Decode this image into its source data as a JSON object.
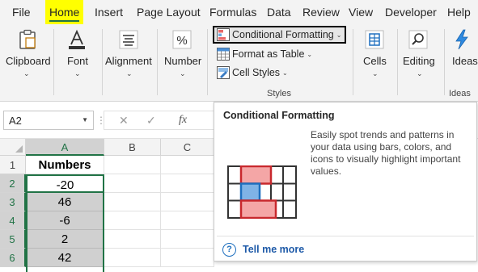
{
  "menu": {
    "tabs": [
      {
        "label": "File",
        "active": false
      },
      {
        "label": "Home",
        "active": true
      },
      {
        "label": "Insert",
        "active": false
      },
      {
        "label": "Page Layout",
        "active": false
      },
      {
        "label": "Formulas",
        "active": false
      },
      {
        "label": "Data",
        "active": false
      },
      {
        "label": "Review",
        "active": false
      },
      {
        "label": "View",
        "active": false
      },
      {
        "label": "Developer",
        "active": false
      },
      {
        "label": "Help",
        "active": false
      }
    ]
  },
  "ribbon": {
    "clipboard": {
      "label": "Clipboard",
      "icon": "clipboard-icon"
    },
    "font": {
      "label": "Font",
      "icon": "font-a-icon"
    },
    "alignment": {
      "label": "Alignment",
      "icon": "align-lines-icon"
    },
    "number": {
      "label": "Number",
      "icon": "percent-icon"
    },
    "styles": {
      "group_label": "Styles",
      "conditional_formatting": "Conditional Formatting",
      "format_as_table": "Format as Table",
      "cell_styles": "Cell Styles"
    },
    "cells": {
      "label": "Cells",
      "icon": "cells-grid-icon"
    },
    "editing": {
      "label": "Editing",
      "icon": "magnifier-icon"
    },
    "ideas": {
      "label": "Ideas",
      "group_label": "Ideas",
      "icon": "lightning-icon"
    }
  },
  "formula_bar": {
    "name_box": "A2",
    "fx_symbol": "fx",
    "formula_value": ""
  },
  "sheet": {
    "columns": [
      "A",
      "B",
      "C"
    ],
    "rows": [
      "1",
      "2",
      "3",
      "4",
      "5",
      "6"
    ],
    "column_a": [
      "Numbers",
      "-20",
      "46",
      "-6",
      "2",
      "42"
    ],
    "selected_column": "A",
    "active_cell": "A2"
  },
  "tooltip": {
    "title": "Conditional Formatting",
    "description": "Easily spot trends and patterns in your data using bars, colors, and icons to visually highlight important values.",
    "link": "Tell me more"
  },
  "colors": {
    "excel_green": "#217346",
    "highlight_yellow": "#ffff00",
    "cf_red": "#f4a6a6",
    "cf_blue": "#7fb3e6",
    "link_blue": "#1e5aa8"
  }
}
